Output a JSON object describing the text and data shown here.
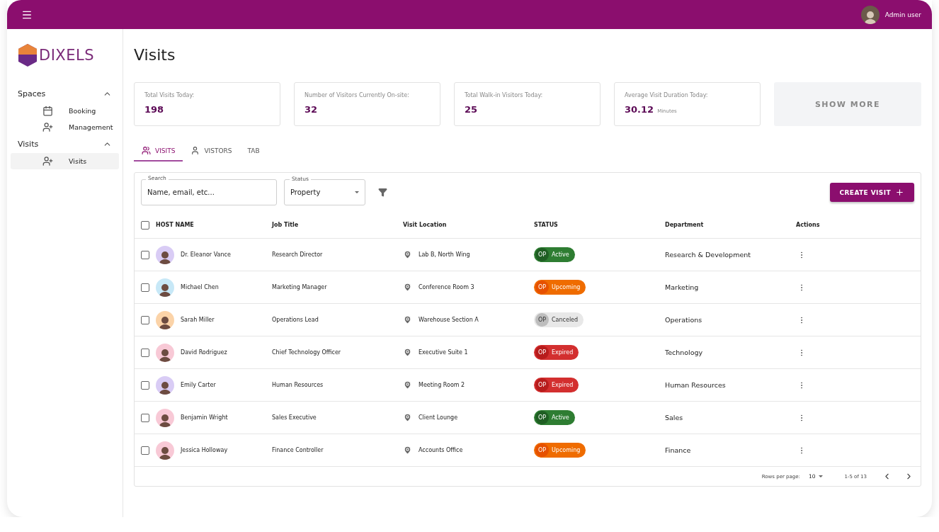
{
  "topbar": {
    "user_name": "Admin user"
  },
  "sidebar": {
    "logo_text": "DIXELS",
    "groups": [
      {
        "label": "Spaces",
        "expanded": true,
        "items": [
          {
            "label": "Booking",
            "selected": false
          },
          {
            "label": "Management",
            "selected": false
          }
        ]
      },
      {
        "label": "Visits",
        "expanded": true,
        "items": [
          {
            "label": "Visits",
            "selected": true
          }
        ]
      }
    ]
  },
  "page": {
    "title": "Visits"
  },
  "stats": [
    {
      "label": "Total Visits Today:",
      "value": "198"
    },
    {
      "label": "Number of Visitors Currently On-site:",
      "value": "32"
    },
    {
      "label": "Total Walk-in Visitors Today:",
      "value": "25"
    },
    {
      "label": "Average Visit Duration Today:",
      "value": "30.12",
      "unit": "Minutes"
    }
  ],
  "show_more": "SHOW MORE",
  "tabs": [
    {
      "label": "VISITS",
      "selected": true
    },
    {
      "label": "VISTORS",
      "selected": false
    },
    {
      "label": "TAB",
      "selected": false
    }
  ],
  "filters": {
    "search": {
      "label": "Search",
      "placeholder": "Name, email, etc..."
    },
    "status": {
      "label": "Status",
      "value": "Property"
    }
  },
  "create_button": "CREATE VISIT",
  "table": {
    "header_checked": false,
    "columns": [
      "HOST NAME",
      "Job Title",
      "Visit Location",
      "STATUS",
      "Department",
      "Actions"
    ],
    "rows": [
      {
        "checked": false,
        "avatar": {
          "color": "#d9ccf5"
        },
        "host": "Dr. Eleanor Vance",
        "job": "Research Director",
        "location": "Lab B, North Wing",
        "status": {
          "badge": "OP",
          "label": "Active",
          "kind": "active"
        },
        "department": "Research & Development"
      },
      {
        "checked": false,
        "avatar": {
          "color": "#c7e8f7"
        },
        "host": "Michael Chen",
        "job": "Marketing Manager",
        "location": "Conference Room 3",
        "status": {
          "badge": "OP",
          "label": "Upcoming",
          "kind": "upcoming"
        },
        "department": "Marketing"
      },
      {
        "checked": false,
        "avatar": {
          "color": "#fbd3a8"
        },
        "host": "Sarah Miller",
        "job": "Operations Lead",
        "location": "Warehouse Section A",
        "status": {
          "badge": "OP",
          "label": "Canceled",
          "kind": "canceled"
        },
        "department": "Operations"
      },
      {
        "checked": false,
        "avatar": {
          "color": "#f8c9d6"
        },
        "host": "David Rodriguez",
        "job": "Chief Technology Officer",
        "location": "Executive Suite 1",
        "status": {
          "badge": "OP",
          "label": "Expired",
          "kind": "expired"
        },
        "department": "Technology"
      },
      {
        "checked": false,
        "avatar": {
          "color": "#d9ccf5"
        },
        "host": "Emily Carter",
        "job": "Human Resources",
        "location": "Meeting Room 2",
        "status": {
          "badge": "OP",
          "label": "Expired",
          "kind": "expired"
        },
        "department": "Human Resources"
      },
      {
        "checked": false,
        "avatar": {
          "color": "#f8c9d6"
        },
        "host": "Benjamin Wright",
        "job": "Sales Executive",
        "location": "Client Lounge",
        "status": {
          "badge": "OP",
          "label": "Active",
          "kind": "active"
        },
        "department": "Sales"
      },
      {
        "checked": false,
        "avatar": {
          "color": "#f8c9d6"
        },
        "host": "Jessica Holloway",
        "job": "Finance Controller",
        "location": "Accounts Office",
        "status": {
          "badge": "OP",
          "label": "Upcoming",
          "kind": "upcoming"
        },
        "department": "Finance"
      }
    ]
  },
  "pagination": {
    "rows_per_page_label": "Rows per page:",
    "rows_per_page": "10",
    "range": "1-5 of 13"
  }
}
